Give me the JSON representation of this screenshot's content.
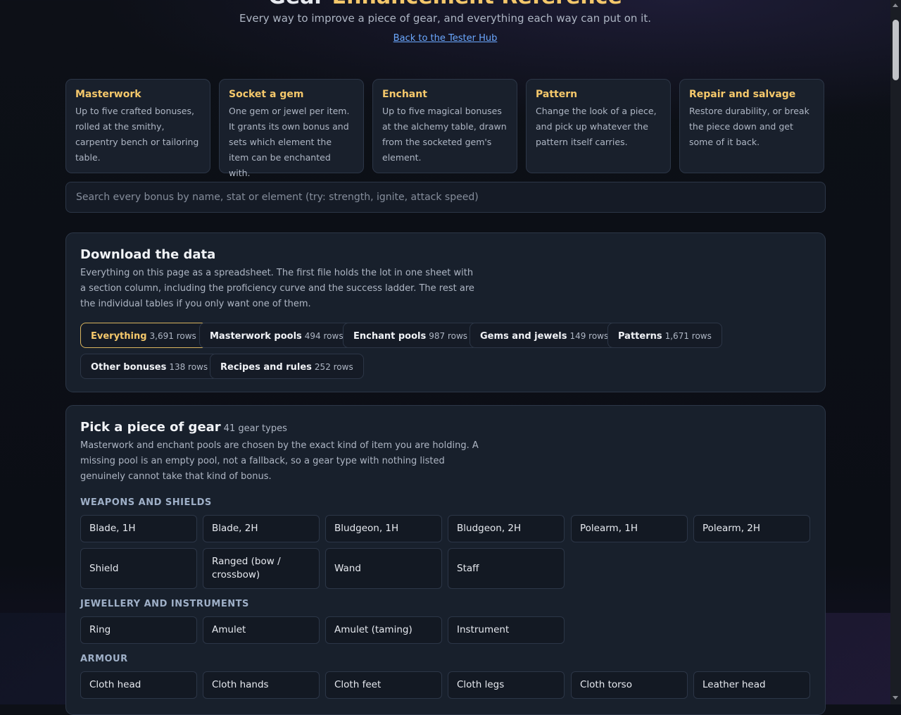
{
  "header": {
    "title_part1": "Gear ",
    "title_part2": "Enhancement Reference",
    "subtitle": "Every way to improve a piece of gear, and everything each way can put on it.",
    "back_link": "Back to the Tester Hub"
  },
  "ways": [
    {
      "title": "Masterwork",
      "desc": "Up to five crafted bonuses, rolled at the smithy, carpentry bench or tailoring table."
    },
    {
      "title": "Socket a gem",
      "desc": "One gem or jewel per item. It grants its own bonus and sets which element the item can be enchanted with."
    },
    {
      "title": "Enchant",
      "desc": "Up to five magical bonuses at the alchemy table, drawn from the socketed gem's element."
    },
    {
      "title": "Pattern",
      "desc": "Change the look of a piece, and pick up whatever the pattern itself carries."
    },
    {
      "title": "Repair and salvage",
      "desc": "Restore durability, or break the piece down and get some of it back."
    }
  ],
  "search": {
    "placeholder": "Search every bonus by name, stat or element (try: strength, ignite, attack speed)"
  },
  "download": {
    "title": "Download the data",
    "desc": "Everything on this page as a spreadsheet. The first file holds the lot in one sheet with a section column, including the proficiency curve and the success ladder. The rest are the individual tables if you only want one of them.",
    "files": [
      {
        "label": "Everything",
        "rows": "3,691 rows",
        "active": true
      },
      {
        "label": "Masterwork pools",
        "rows": "494 rows"
      },
      {
        "label": "Enchant pools",
        "rows": "987 rows"
      },
      {
        "label": "Gems and jewels",
        "rows": "149 rows"
      },
      {
        "label": "Patterns",
        "rows": "1,671 rows"
      },
      {
        "label": "Other bonuses",
        "rows": "138 rows"
      },
      {
        "label": "Recipes and rules",
        "rows": "252 rows"
      }
    ]
  },
  "gear_picker": {
    "title": "Pick a piece of gear",
    "count": "41 gear types",
    "desc": "Masterwork and enchant pools are chosen by the exact kind of item you are holding. A missing pool is an empty pool, not a fallback, so a gear type with nothing listed genuinely cannot take that kind of bonus.",
    "groups": [
      {
        "label": "WEAPONS AND SHIELDS",
        "items": [
          "Blade, 1H",
          "Blade, 2H",
          "Bludgeon, 1H",
          "Bludgeon, 2H",
          "Polearm, 1H",
          "Polearm, 2H",
          "Shield",
          "Ranged (bow / crossbow)",
          "Wand",
          "Staff"
        ]
      },
      {
        "label": "JEWELLERY AND INSTRUMENTS",
        "items": [
          "Ring",
          "Amulet",
          "Amulet (taming)",
          "Instrument"
        ]
      },
      {
        "label": "ARMOUR",
        "items": [
          "Cloth head",
          "Cloth hands",
          "Cloth feet",
          "Cloth legs",
          "Cloth torso",
          "Leather head"
        ]
      }
    ]
  }
}
